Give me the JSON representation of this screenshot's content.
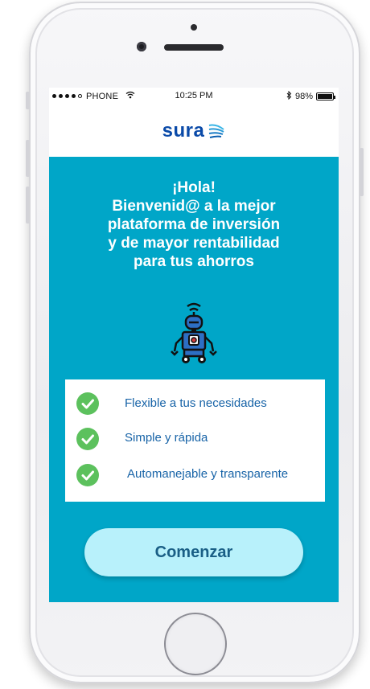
{
  "status_bar": {
    "carrier": "PHONE",
    "time": "10:25 PM",
    "battery": "98%",
    "battery_level": 0.98
  },
  "header": {
    "logo_text": "sura"
  },
  "welcome": {
    "lines": [
      "¡Hola!",
      "Bienvenid@ a la mejor",
      "plataforma de inversión",
      "y de mayor rentabilidad",
      "para tus ahorros"
    ]
  },
  "features": [
    {
      "label": "Flexible a tus necesidades",
      "icon": "check-circle-icon"
    },
    {
      "label": "Simple y rápida",
      "icon": "check-circle-icon"
    },
    {
      "label": "Automanejable y transparente",
      "icon": "check-circle-icon"
    }
  ],
  "cta": {
    "label": "Comenzar"
  },
  "colors": {
    "brand_blue": "#0a4aa8",
    "screen_background": "#00a6c8",
    "check_green": "#5cc15d",
    "feature_text": "#1763a7",
    "cta_background": "#b8f1fb",
    "cta_text": "#1a5f86"
  }
}
